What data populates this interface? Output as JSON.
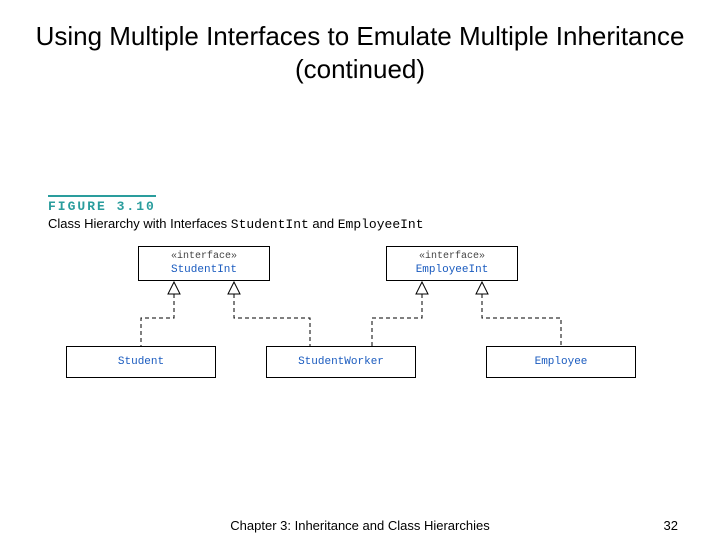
{
  "title": "Using Multiple Interfaces to Emulate Multiple Inheritance (continued)",
  "figure": {
    "label": "FIGURE 3.10",
    "caption_prefix": "Class Hierarchy with Interfaces ",
    "caption_code1": "StudentInt",
    "caption_mid": " and ",
    "caption_code2": "EmployeeInt"
  },
  "diagram": {
    "stereotype": "«interface»",
    "interfaces": [
      {
        "name": "StudentInt"
      },
      {
        "name": "EmployeeInt"
      }
    ],
    "classes": [
      {
        "name": "Student"
      },
      {
        "name": "StudentWorker"
      },
      {
        "name": "Employee"
      }
    ],
    "realizations": [
      {
        "from": "Student",
        "to": "StudentInt"
      },
      {
        "from": "StudentWorker",
        "to": "StudentInt"
      },
      {
        "from": "StudentWorker",
        "to": "EmployeeInt"
      },
      {
        "from": "Employee",
        "to": "EmployeeInt"
      }
    ]
  },
  "footer": {
    "chapter": "Chapter 3: Inheritance and Class Hierarchies",
    "page": "32"
  }
}
